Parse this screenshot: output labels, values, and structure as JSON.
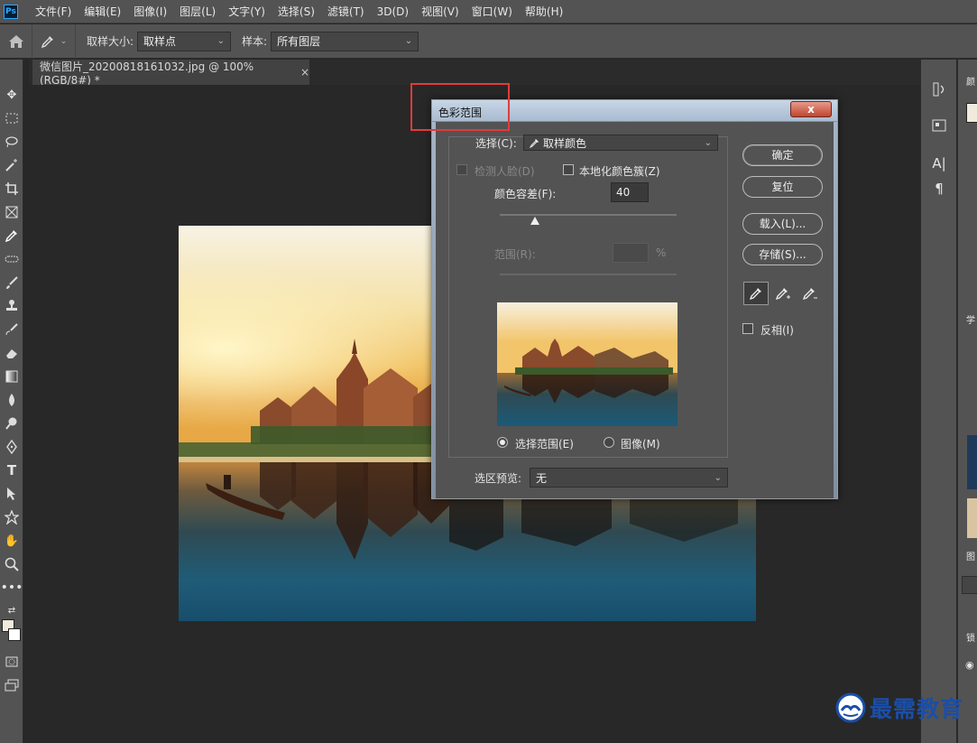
{
  "app": {
    "logo": "Ps"
  },
  "menu": [
    "文件(F)",
    "编辑(E)",
    "图像(I)",
    "图层(L)",
    "文字(Y)",
    "选择(S)",
    "滤镜(T)",
    "3D(D)",
    "视图(V)",
    "窗口(W)",
    "帮助(H)"
  ],
  "options": {
    "sample_size_label": "取样大小:",
    "sample_size_value": "取样点",
    "sample_label": "样本:",
    "sample_value": "所有图层"
  },
  "document": {
    "tab_title": "微信图片_20200818161032.jpg @ 100%(RGB/8#) *",
    "close": "×"
  },
  "dialog": {
    "title": "色彩范围",
    "close": "x",
    "select_label": "选择(C):",
    "select_value": "取样颜色",
    "detect_faces": "检测人脸(D)",
    "localized": "本地化颜色簇(Z)",
    "fuzziness_label": "颜色容差(F):",
    "fuzziness_value": "40",
    "fuzziness_level": 0.2,
    "range_label": "范围(R):",
    "range_value": "",
    "range_unit": "%",
    "radio_selection": "选择范围(E)",
    "radio_image": "图像(M)",
    "preview_label": "选区预览:",
    "preview_value": "无",
    "buttons": {
      "ok": "确定",
      "reset": "复位",
      "load": "载入(L)...",
      "save": "存储(S)..."
    },
    "invert": "反相(I)"
  },
  "right_panel": {
    "label_top": "颜",
    "label_learn": "学",
    "label_layers": "图",
    "label_lock": "锁"
  },
  "watermark": {
    "text": "最需教育"
  },
  "colors": {
    "chrome": "#535353",
    "canvas": "#282828",
    "highlight": "#e23b3b",
    "watermark": "#1b4ea8"
  }
}
